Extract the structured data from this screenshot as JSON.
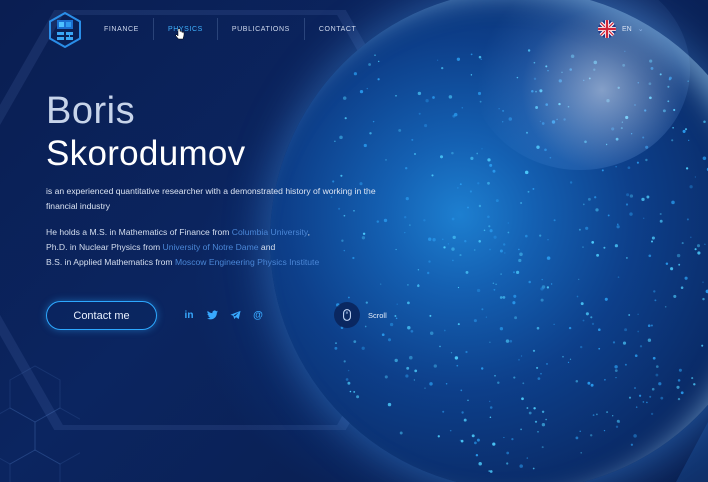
{
  "nav": {
    "items": [
      {
        "label": "FINANCE",
        "active": false
      },
      {
        "label": "PHYSICS",
        "active": true
      },
      {
        "label": "PUBLICATIONS",
        "active": false
      },
      {
        "label": "CONTACT",
        "active": false
      }
    ],
    "language": {
      "label": "EN",
      "flag": "uk-flag-icon"
    }
  },
  "hero": {
    "first_name": "Boris",
    "last_name": "Skorodumov",
    "intro": "is an experienced quantitative researcher with a demonstrated history of working in the financial industry",
    "education": [
      {
        "prefix": "He holds a M.S. in Mathematics of Finance from ",
        "institution": "Columbia University",
        "suffix": ","
      },
      {
        "prefix": "Ph.D. in Nuclear Physics from ",
        "institution": "University of Notre Dame",
        "suffix": " and"
      },
      {
        "prefix": "B.S. in Applied Mathematics from ",
        "institution": "Moscow Engineering Physics Institute",
        "suffix": ""
      }
    ],
    "contact_label": "Contact me",
    "scroll_label": "Scroll"
  },
  "social": [
    "linkedin-icon",
    "twitter-icon",
    "telegram-icon",
    "email-icon"
  ],
  "colors": {
    "accent": "#2da8ff",
    "active_nav": "#3fb2ff",
    "institution_link": "#4a86d6",
    "background": "#0a1d4a"
  }
}
